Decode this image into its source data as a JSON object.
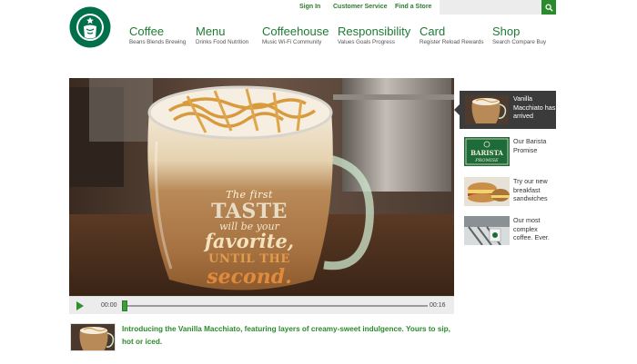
{
  "brand": {
    "logo_icon": "starbucks-siren-logo",
    "color": "#1e7b34"
  },
  "utility_nav": [
    "Sign In",
    "Customer Service",
    "Find a Store"
  ],
  "search": {
    "placeholder": "",
    "icon": "search-icon"
  },
  "main_nav": [
    {
      "title": "Coffee",
      "sub": "Beans Blends Brewing"
    },
    {
      "title": "Menu",
      "sub": "Drinks Food Nutrition"
    },
    {
      "title": "Coffeehouse",
      "sub": "Music Wi-Fi Community"
    },
    {
      "title": "Responsibility",
      "sub": "Values Goals Progress"
    },
    {
      "title": "Card",
      "sub": "Register Reload Rewards"
    },
    {
      "title": "Shop",
      "sub": "Search Compare Buy"
    }
  ],
  "hero": {
    "line1": "TASTE",
    "line1_prefix": "The first",
    "line2": "will be your",
    "line3": "favorite,",
    "line4": "UNTIL THE",
    "line5": "second."
  },
  "player": {
    "current_time": "00:00",
    "duration": "00:16",
    "progress": 0
  },
  "caption": "Introducing the Vanilla Macchiato, featuring layers of creamy-sweet indulgence. Yours to sip, hot or iced.",
  "sidebar": [
    {
      "label": "Vanilla Macchiato has arrived",
      "active": true
    },
    {
      "label": "Our Barista Promise",
      "active": false,
      "badge_line1": "BARISTA",
      "badge_line2": "PROMISE"
    },
    {
      "label": "Try our new breakfast sandwiches",
      "active": false
    },
    {
      "label": "Our most complex coffee. Ever.",
      "active": false
    }
  ]
}
